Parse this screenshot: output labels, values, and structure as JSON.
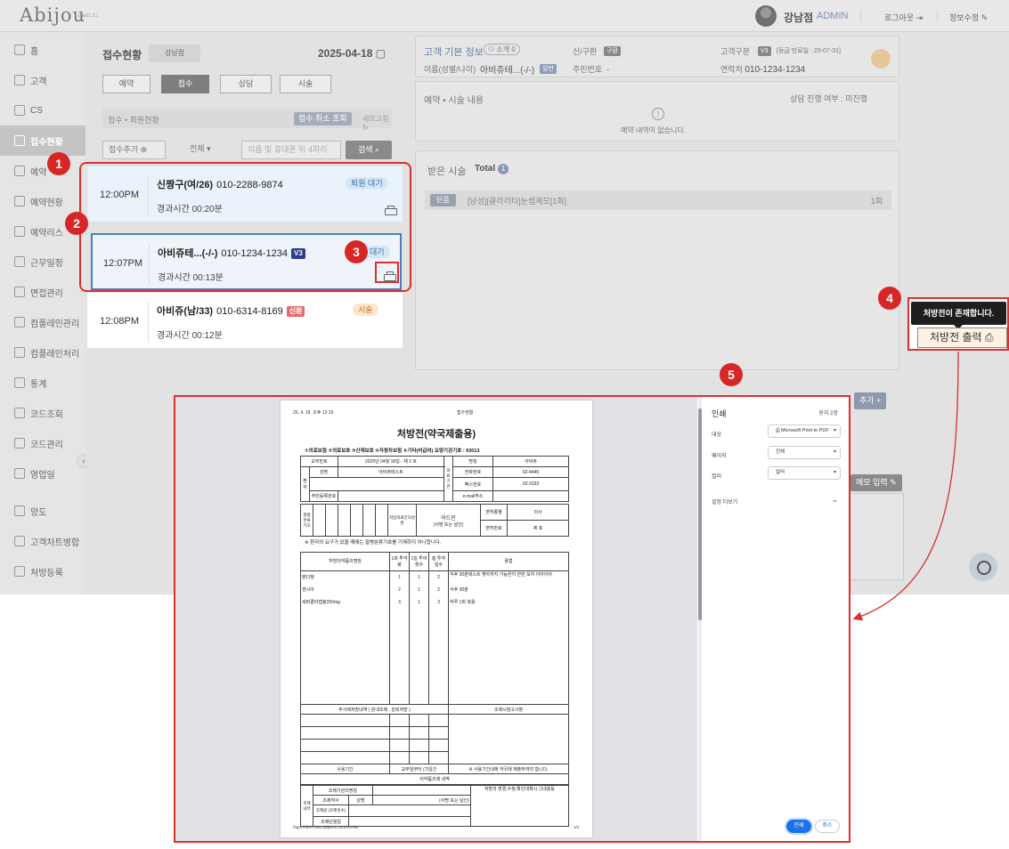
{
  "app": {
    "logo": "Abijou",
    "version": "prod/1.3.1",
    "user_name": "강남점",
    "user_role": "ADMIN",
    "logout": "로그아웃",
    "edit_info": "정보수정"
  },
  "sidebar": {
    "items": [
      {
        "label": "홈"
      },
      {
        "label": "고객"
      },
      {
        "label": "CS"
      },
      {
        "label": "접수현황"
      },
      {
        "label": "예약"
      },
      {
        "label": "예약현황"
      },
      {
        "label": "예약리스"
      },
      {
        "label": "근무일정"
      },
      {
        "label": "면접관리"
      },
      {
        "label": "컴플레인관리"
      },
      {
        "label": "컴플레인처리"
      },
      {
        "label": "통계"
      },
      {
        "label": "코드조회"
      },
      {
        "label": "코드관리"
      },
      {
        "label": "영업일"
      },
      {
        "label": "양도"
      },
      {
        "label": "고객차트병합"
      },
      {
        "label": "처방등록"
      }
    ]
  },
  "reception": {
    "title": "접수현황",
    "branch": "강남점",
    "date": "2025-04-18",
    "tabs": [
      "예약",
      "접수",
      "상담",
      "시술"
    ],
    "sub_label": "접수 • 회원현황",
    "cancel_lookup": "접수 취소 조회",
    "refresh": "새로고침",
    "add_button": "접수추가",
    "filter_all": "전체",
    "search_placeholder": "이름 및 휴대폰 뒤 4자리",
    "search_button": "검색",
    "cards": [
      {
        "time": "12:00PM",
        "name": "신짱구(여/26)",
        "phone": "010-2288-9874",
        "tag": "",
        "status": "퇴원 대기",
        "elapsed": "경과시간 00:20분"
      },
      {
        "time": "12:07PM",
        "name": "아비쥬테...(-/-)",
        "phone": "010-1234-1234",
        "tag": "V3",
        "status": "대기",
        "elapsed": "경과시간 00:13분"
      },
      {
        "time": "12:08PM",
        "name": "아비쥬(남/33)",
        "phone": "010-6314-8169",
        "tag": "신환",
        "status": "시술",
        "elapsed": "경과시간 00:12분"
      }
    ]
  },
  "customer": {
    "title": "고객 기본 정보",
    "intro_count": "소개 0",
    "new_old_label": "신/구환",
    "new_old_value": "구환",
    "grade_label": "고객구분",
    "grade_tag": "V3",
    "grade_note": "[등급 만료일 : 25-07-31]",
    "name_label": "이름(성별/나이)",
    "name_value": "아비쥬테...(-/-)",
    "name_tag": "일반",
    "id_label": "주민번호",
    "id_value": "-",
    "phone_label": "연락처",
    "phone_value": "010-1234-1234",
    "reserve_title": "예약 • 시술 내용",
    "consult_status": "상담 진행 여부 : 미진행",
    "no_reserve": "예약 내역이 없습니다.",
    "treat_title": "받은 시술",
    "treat_total_label": "Total",
    "treat_total": "1",
    "treat_tag": "단품",
    "treat_name": "[남성][클라리티]눈썹제모[1회]",
    "treat_count": "1회",
    "add_label": "추가",
    "memo_input": "메모 입력"
  },
  "tooltip": {
    "text": "처방전이 존재합니다.",
    "print_button": "처방전 출력"
  },
  "markers": [
    "1",
    "2",
    "3",
    "4",
    "5"
  ],
  "print_dialog": {
    "title": "인쇄",
    "pages": "용지 2장",
    "dest_label": "대상",
    "dest_value": "Microsoft Print to PDF",
    "page_label": "페이지",
    "page_value": "전체",
    "color_label": "컬러",
    "color_value": "컬러",
    "more_settings": "설정 더보기",
    "print_button": "인쇄",
    "cancel_button": "취소"
  },
  "document": {
    "header_date": "25. 4. 18. 오후 12:19",
    "header_title": "접수현황",
    "title": "처방전(약국제출용)",
    "insurance_line": "①의료보험 ②의료보호 ③산재보호 ④자동차보험 ⑤기타(비급여) 요양기관기호 : 93013",
    "issue_no_label": "교부번호",
    "issue_no_value": "2025년 04월 18일 - 제 2 호",
    "patient_label": "환자",
    "name_label": "성명",
    "name_value": "아비쥬테스트",
    "rrn_label": "주민등록번호",
    "inst_label": "의료기관",
    "inst_name_label": "명칭",
    "inst_name_value": "아비쥬",
    "tel_label": "전화번호",
    "tel_value": "02-4445",
    "fax_label": "팩스번호",
    "fax_value": "02-3333",
    "email_label": "e-mail주소",
    "disease_label": "질병분류기호",
    "doctor_label": "처방의료인의성명",
    "doctor_value": "어드민",
    "sign_label": "(서명 또는 날인)",
    "license_type_label": "면허종별",
    "license_type_value": "의사",
    "license_no_label": "면허번호",
    "license_no_value": "제 호",
    "patient_note": "※ 환자의 요구가 있을 때에는 질병분류기호를 기재하지 아니합니다.",
    "med_headers": [
      "처방의약품의명칭",
      "1회 투약량",
      "1일 투여횟수",
      "총 투약일수",
      "용법"
    ],
    "meds": [
      {
        "name": "렌디정",
        "dose": "1",
        "times": "1",
        "days": "2",
        "usage": "식후 30분테스트 몇자까지 가능한지 한번 보자 아아아아"
      },
      {
        "name": "센시아",
        "dose": "2",
        "times": "1",
        "days": "2",
        "usage": "식후 30분"
      },
      {
        "name": "세파클러캡슐250mg",
        "dose": "3",
        "times": "1",
        "days": "3",
        "usage": "하루 1회 복용"
      }
    ],
    "injection_label": "주사제처방내역 ( 원내조제 , 원외처방 )",
    "dispense_ref_label": "조제시참고사항",
    "period_label": "사용기간",
    "period_value": "교부일부터 (7)일간",
    "period_note": "※ 사용기간내에 약국에 제출하여야 합니다.",
    "dispense_title": "의약품조제 내역",
    "dispense_side_label": "조제내역",
    "pharmacy_label": "조제기관의명칭",
    "pharmacist_label": "조제약사",
    "pharmacist_name_label": "성명",
    "pharmacist_sign": "(서명 또는 날인)",
    "amount_label": "조제량 (조제일수)",
    "date_label": "조제년월일",
    "change_note": "처방의 변경,수정,확인대체시 그내용등",
    "footer_url": "https://dev-chart.abijemr.com/receive",
    "footer_page": "1/2"
  }
}
